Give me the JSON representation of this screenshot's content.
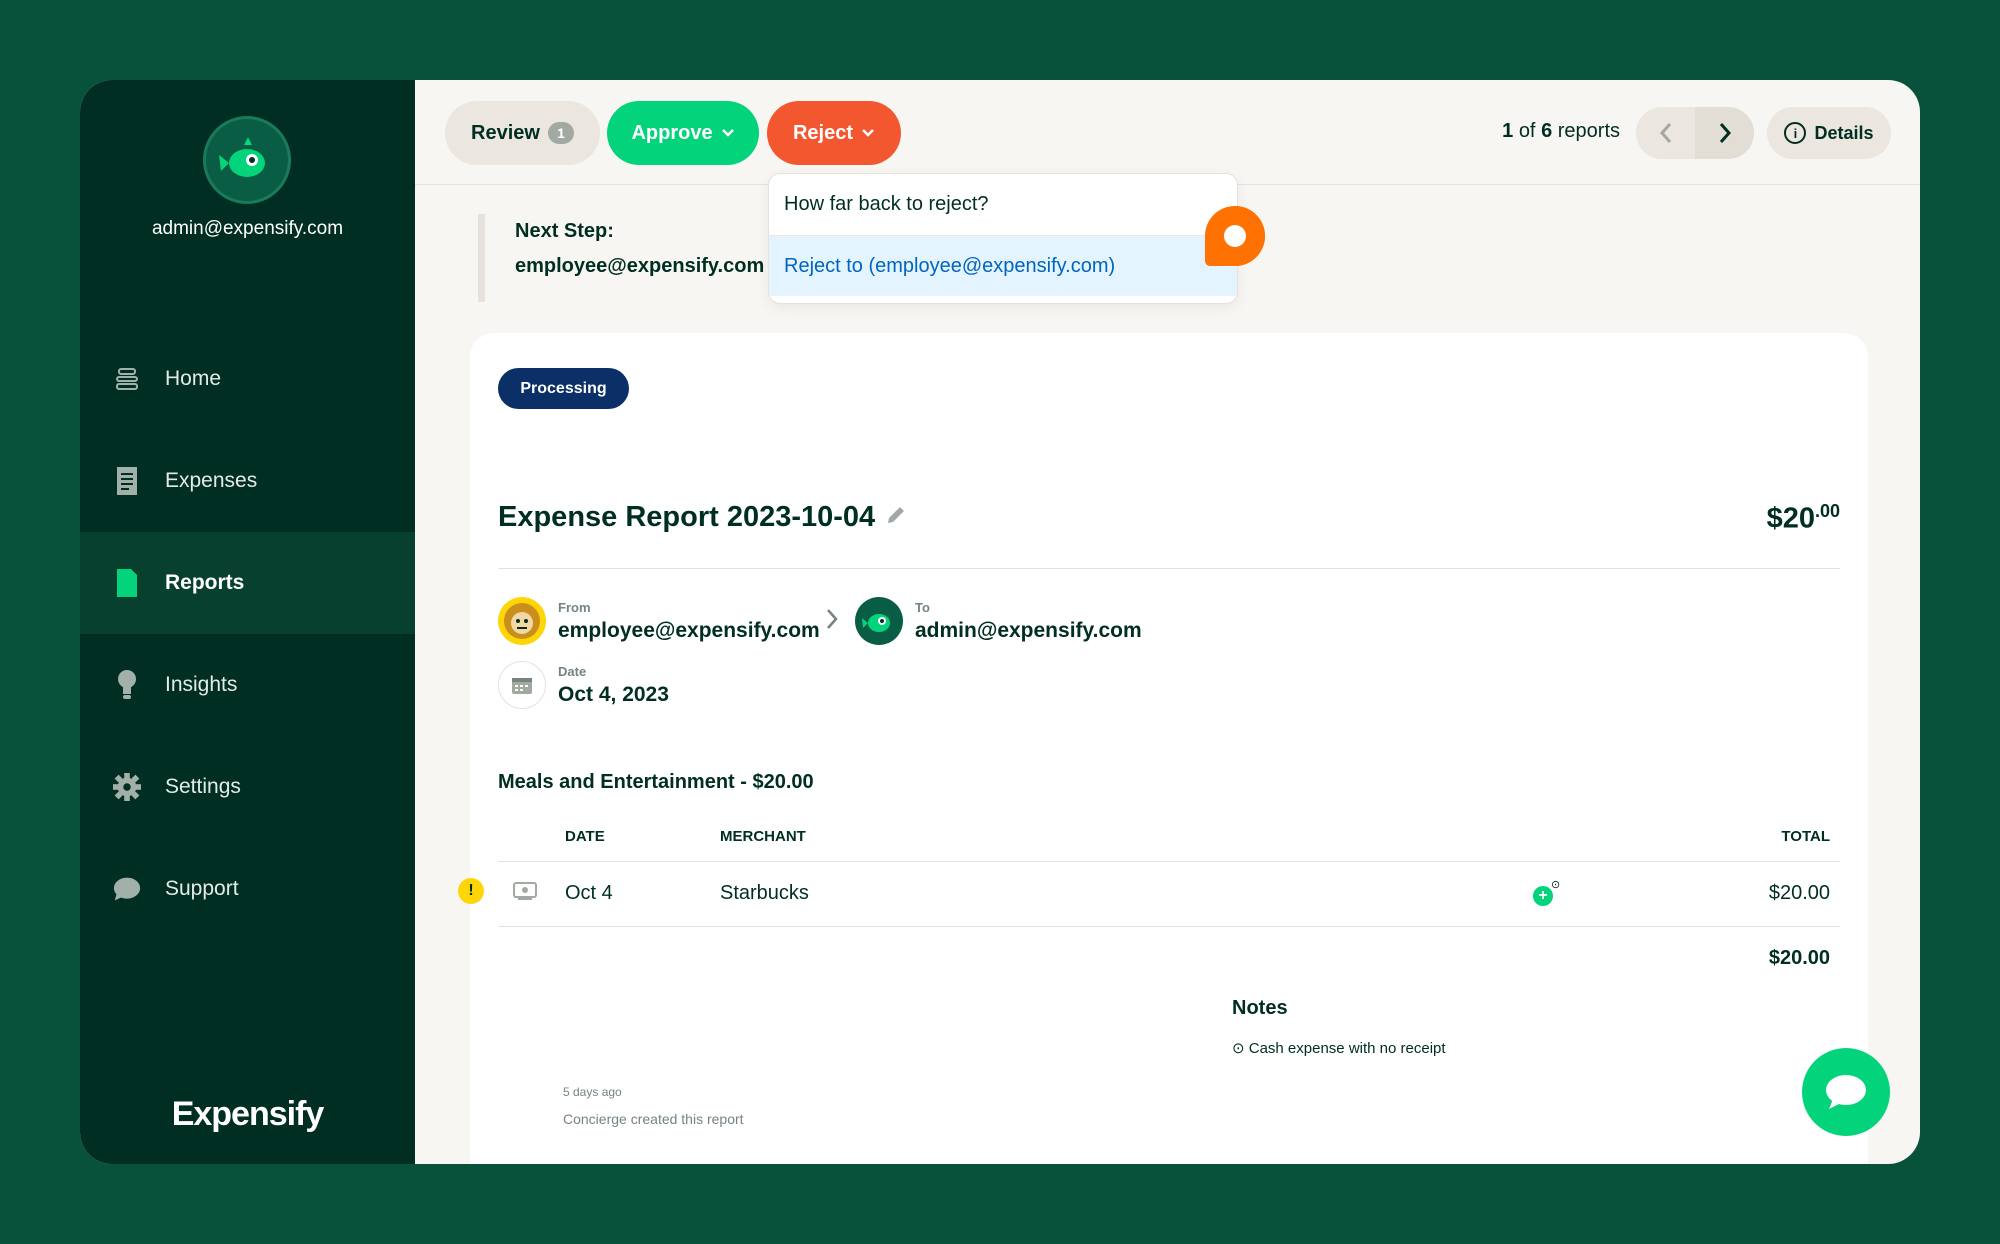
{
  "sidebar": {
    "email": "admin@expensify.com",
    "items": [
      {
        "label": "Home",
        "icon": "home-icon"
      },
      {
        "label": "Expenses",
        "icon": "receipt-icon"
      },
      {
        "label": "Reports",
        "icon": "document-icon"
      },
      {
        "label": "Insights",
        "icon": "lightbulb-icon"
      },
      {
        "label": "Settings",
        "icon": "gear-icon"
      },
      {
        "label": "Support",
        "icon": "chat-bubble-icon"
      }
    ],
    "active_item": "Reports",
    "brand": "Expensify"
  },
  "toolbar": {
    "review_label": "Review",
    "review_count": "1",
    "approve_label": "Approve",
    "reject_label": "Reject",
    "pager_current": "1",
    "pager_of": "of",
    "pager_total": "6",
    "pager_suffix": "reports",
    "details_label": "Details"
  },
  "next_step": {
    "label": "Next Step:",
    "value": "employee@expensify.com"
  },
  "reject_menu": {
    "title": "How far back to reject?",
    "option": "Reject to (employee@expensify.com)"
  },
  "report": {
    "status": "Processing",
    "title": "Expense Report 2023-10-04",
    "total_main": "$20",
    "total_cents": ".00",
    "from_label": "From",
    "from_value": "employee@expensify.com",
    "to_label": "To",
    "to_value": "admin@expensify.com",
    "date_label": "Date",
    "date_value": "Oct 4, 2023",
    "section_title": "Meals and Entertainment - $20.00",
    "columns": {
      "date": "DATE",
      "merchant": "MERCHANT",
      "total": "TOTAL"
    },
    "rows": [
      {
        "date": "Oct 4",
        "merchant": "Starbucks",
        "total": "$20.00"
      }
    ],
    "grand_total": "$20.00",
    "notes_title": "Notes",
    "notes_text": "Cash expense with no receipt",
    "activity_time": "5 days ago",
    "activity_text": "Concierge created this report"
  },
  "colors": {
    "background": "#08513a",
    "sidebar": "#002e22",
    "approve": "#03d47c",
    "reject": "#f25730",
    "status_pill": "#0b2f67",
    "link": "#0164bf"
  }
}
